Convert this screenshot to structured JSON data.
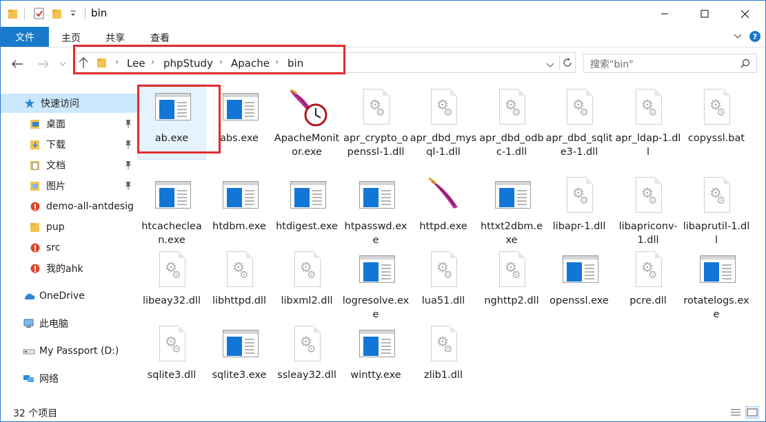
{
  "window": {
    "title": "bin"
  },
  "ribbon": {
    "file_tab": "文件",
    "tabs": [
      "主页",
      "共享",
      "查看"
    ]
  },
  "address": {
    "crumbs": [
      "Lee",
      "phpStudy",
      "Apache",
      "bin"
    ],
    "search_placeholder": "搜索\"bin\""
  },
  "sidebar": {
    "items": [
      {
        "label": "快速访问"
      },
      {
        "label": "桌面"
      },
      {
        "label": "下载"
      },
      {
        "label": "文档"
      },
      {
        "label": "图片"
      },
      {
        "label": "demo-all-antdesig"
      },
      {
        "label": "pup"
      },
      {
        "label": "src"
      },
      {
        "label": "我的ahk"
      },
      {
        "label": "OneDrive"
      },
      {
        "label": "此电脑"
      },
      {
        "label": "My Passport (D:)"
      },
      {
        "label": "网络"
      }
    ]
  },
  "files": [
    {
      "name": "ab.exe",
      "type": "exe"
    },
    {
      "name": "abs.exe",
      "type": "exe"
    },
    {
      "name": "ApacheMonitor.exe",
      "type": "monitor"
    },
    {
      "name": "apr_crypto_openssl-1.dll",
      "type": "dll"
    },
    {
      "name": "apr_dbd_mysql-1.dll",
      "type": "dll"
    },
    {
      "name": "apr_dbd_odbc-1.dll",
      "type": "dll"
    },
    {
      "name": "apr_dbd_sqlite3-1.dll",
      "type": "dll"
    },
    {
      "name": "apr_ldap-1.dll",
      "type": "dll"
    },
    {
      "name": "copyssl.bat",
      "type": "dll"
    },
    {
      "name": "htcacheclean.exe",
      "type": "exe"
    },
    {
      "name": "htdbm.exe",
      "type": "exe"
    },
    {
      "name": "htdigest.exe",
      "type": "exe"
    },
    {
      "name": "htpasswd.exe",
      "type": "exe"
    },
    {
      "name": "httpd.exe",
      "type": "feather"
    },
    {
      "name": "httxt2dbm.exe",
      "type": "exe"
    },
    {
      "name": "libapr-1.dll",
      "type": "dll"
    },
    {
      "name": "libapriconv-1.dll",
      "type": "dll"
    },
    {
      "name": "libaprutil-1.dll",
      "type": "dll"
    },
    {
      "name": "libeay32.dll",
      "type": "dll"
    },
    {
      "name": "libhttpd.dll",
      "type": "dll"
    },
    {
      "name": "libxml2.dll",
      "type": "dll"
    },
    {
      "name": "logresolve.exe",
      "type": "exe"
    },
    {
      "name": "lua51.dll",
      "type": "dll"
    },
    {
      "name": "nghttp2.dll",
      "type": "dll"
    },
    {
      "name": "openssl.exe",
      "type": "exe"
    },
    {
      "name": "pcre.dll",
      "type": "dll"
    },
    {
      "name": "rotatelogs.exe",
      "type": "exe"
    },
    {
      "name": "sqlite3.dll",
      "type": "dll"
    },
    {
      "name": "sqlite3.exe",
      "type": "exe"
    },
    {
      "name": "ssleay32.dll",
      "type": "dll"
    },
    {
      "name": "wintty.exe",
      "type": "exe"
    },
    {
      "name": "zlib1.dll",
      "type": "dll"
    }
  ],
  "status": {
    "item_count": "32 个项目"
  },
  "colors": {
    "accent": "#1979ca",
    "highlight_box": "#e32a2a",
    "selection": "#cce8ff"
  }
}
